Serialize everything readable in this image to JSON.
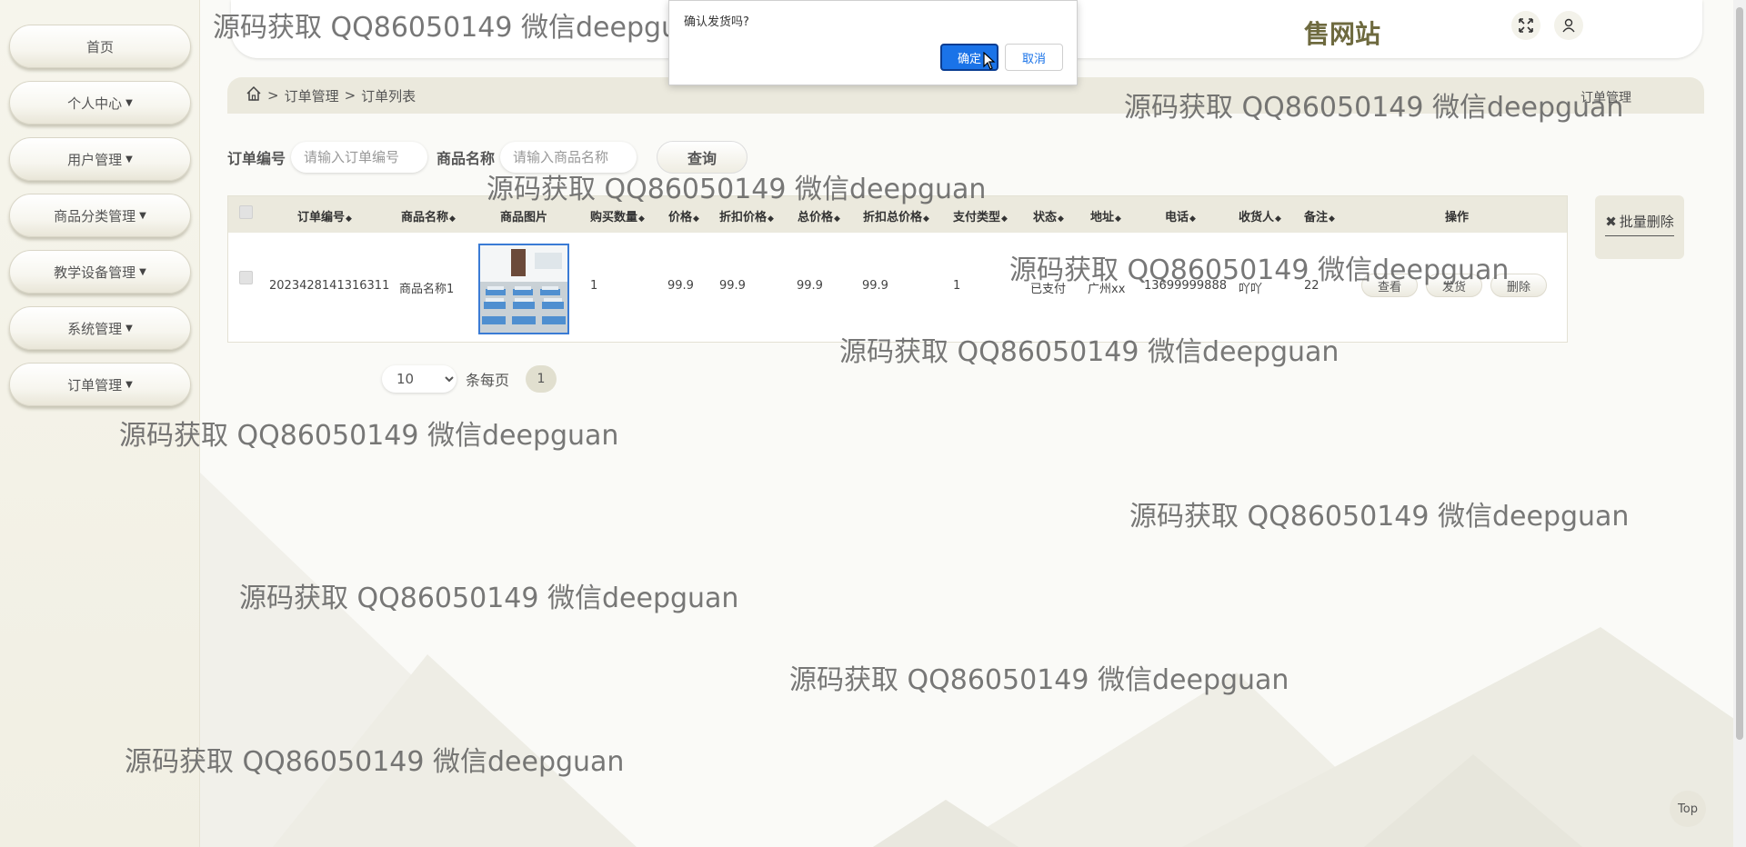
{
  "sidebar": {
    "items": [
      {
        "label": "首页",
        "has_caret": false
      },
      {
        "label": "个人中心",
        "has_caret": true
      },
      {
        "label": "用户管理",
        "has_caret": true
      },
      {
        "label": "商品分类管理",
        "has_caret": true
      },
      {
        "label": "教学设备管理",
        "has_caret": true
      },
      {
        "label": "系统管理",
        "has_caret": true
      },
      {
        "label": "订单管理",
        "has_caret": true
      }
    ]
  },
  "header": {
    "title_visible_fragment": "售网站",
    "icons": [
      "fullscreen-icon",
      "user-icon"
    ]
  },
  "breadcrumb": {
    "home_icon": "home-icon",
    "sep": ">",
    "items": [
      "订单管理",
      "订单列表"
    ],
    "right_label": "订单管理"
  },
  "search": {
    "order_no_label": "订单编号",
    "order_no_placeholder": "请输入订单编号",
    "product_label": "商品名称",
    "product_placeholder": "请输入商品名称",
    "query_label": "查询"
  },
  "table": {
    "columns": [
      "订单编号",
      "商品名称",
      "商品图片",
      "购买数量",
      "价格",
      "折扣价格",
      "总价格",
      "折扣总价格",
      "支付类型",
      "状态",
      "地址",
      "电话",
      "收货人",
      "备注",
      "操作"
    ],
    "rows": [
      {
        "order_no": "2023428141316311",
        "product_name": "商品名称1",
        "image": "classroom-photo",
        "quantity": "1",
        "price": "99.9",
        "discount_price": "99.9",
        "total_price": "99.9",
        "discount_total": "99.9",
        "pay_type": "1",
        "status": "已支付",
        "address": "广州xx",
        "phone": "13699999888",
        "receiver": "吖吖",
        "remark": "22",
        "actions": [
          "查看",
          "发货",
          "删除"
        ]
      }
    ]
  },
  "batch_delete": {
    "icon": "close-icon",
    "label": "批量删除"
  },
  "pagination": {
    "page_size": "10",
    "per_page_label": "条每页",
    "current_page": "1"
  },
  "dialog": {
    "message": "确认发货吗?",
    "ok_label": "确定",
    "cancel_label": "取消"
  },
  "top_button": "Top",
  "watermark": "源码获取 QQ86050149 微信deepguan",
  "colors": {
    "accent": "#1a73e8",
    "title": "#6e6a3f",
    "table_header": "#ebe9dd"
  }
}
